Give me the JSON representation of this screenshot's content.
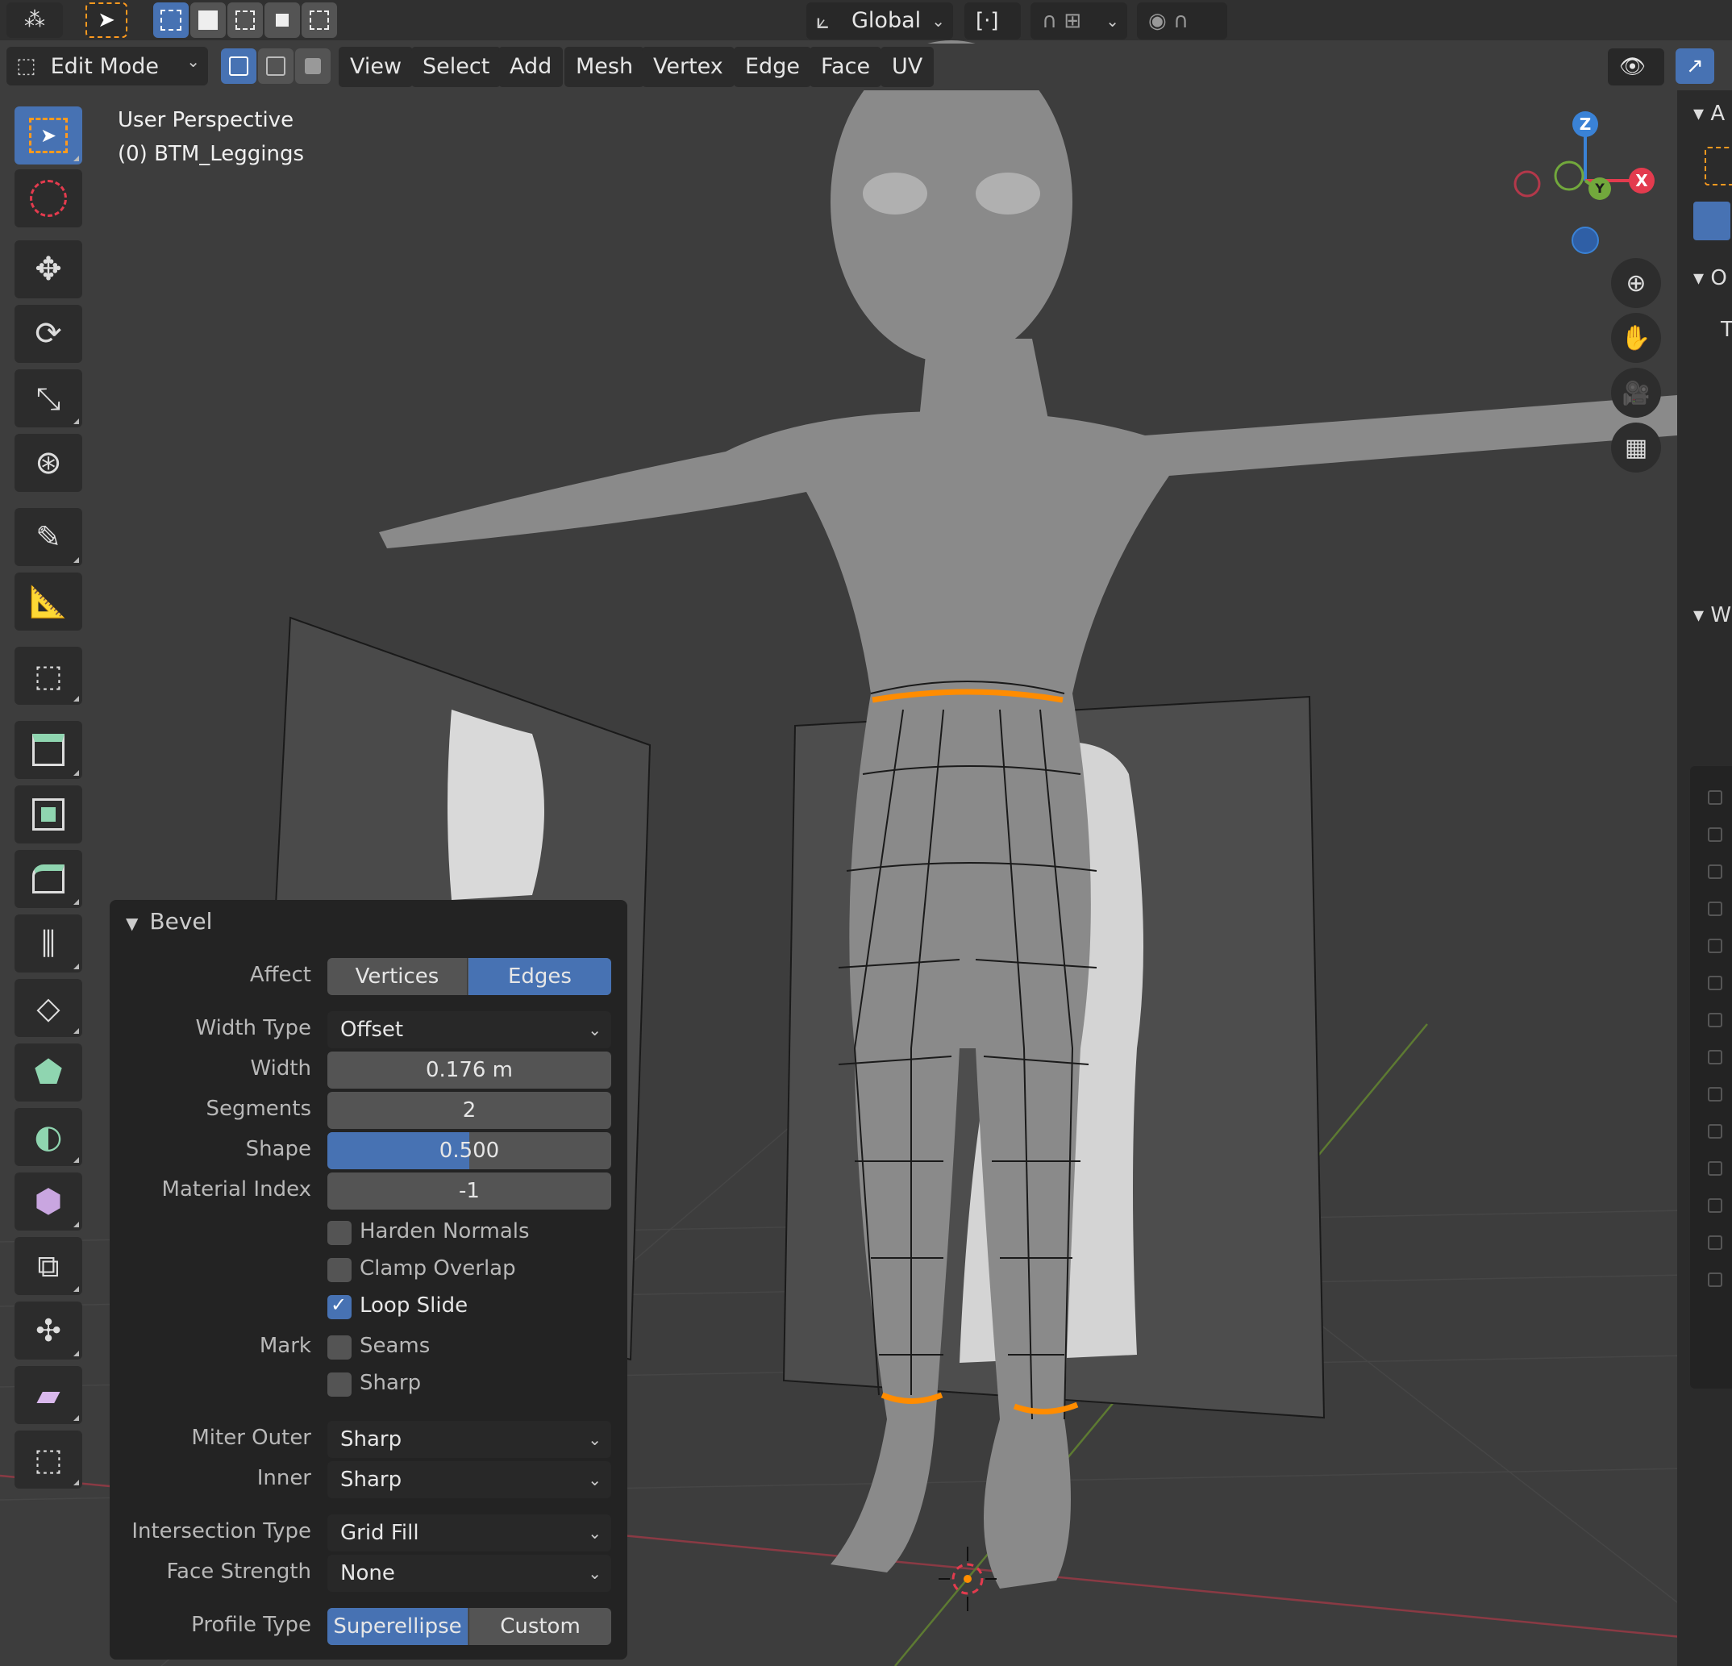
{
  "header": {
    "orientation": "Global",
    "mode": "Edit Mode",
    "menus": [
      "View",
      "Select",
      "Add",
      "Mesh",
      "Vertex",
      "Edge",
      "Face",
      "UV"
    ]
  },
  "viewport": {
    "view_name": "User Perspective",
    "object_name": "(0) BTM_Leggings",
    "gizmo": {
      "z": "Z",
      "y": "Y",
      "x": "X"
    }
  },
  "side_panel": {
    "labels": [
      "A",
      "O",
      "T",
      "W"
    ]
  },
  "bevel": {
    "title": "Bevel",
    "affect": {
      "label": "Affect",
      "options": [
        "Vertices",
        "Edges"
      ],
      "selected": "Edges"
    },
    "width_type": {
      "label": "Width Type",
      "value": "Offset"
    },
    "width": {
      "label": "Width",
      "value": "0.176 m"
    },
    "segments": {
      "label": "Segments",
      "value": "2"
    },
    "shape": {
      "label": "Shape",
      "value": "0.500",
      "fill": 0.5
    },
    "material_index": {
      "label": "Material Index",
      "value": "-1"
    },
    "harden_normals": {
      "label": "Harden Normals",
      "checked": false
    },
    "clamp_overlap": {
      "label": "Clamp Overlap",
      "checked": false
    },
    "loop_slide": {
      "label": "Loop Slide",
      "checked": true
    },
    "mark": {
      "label": "Mark",
      "seams": "Seams",
      "sharp": "Sharp"
    },
    "miter_outer": {
      "label": "Miter Outer",
      "value": "Sharp"
    },
    "inner": {
      "label": "Inner",
      "value": "Sharp"
    },
    "intersection_type": {
      "label": "Intersection Type",
      "value": "Grid Fill"
    },
    "face_strength": {
      "label": "Face Strength",
      "value": "None"
    },
    "profile_type": {
      "label": "Profile Type",
      "options": [
        "Superellipse",
        "Custom"
      ],
      "selected": "Superellipse"
    }
  },
  "colors": {
    "accent": "#4772b3",
    "selected_edge": "#ff8c00",
    "panel": "#232323",
    "axis_x": "#e33b4e",
    "axis_y": "#72a83c",
    "axis_z": "#3a82d6"
  }
}
